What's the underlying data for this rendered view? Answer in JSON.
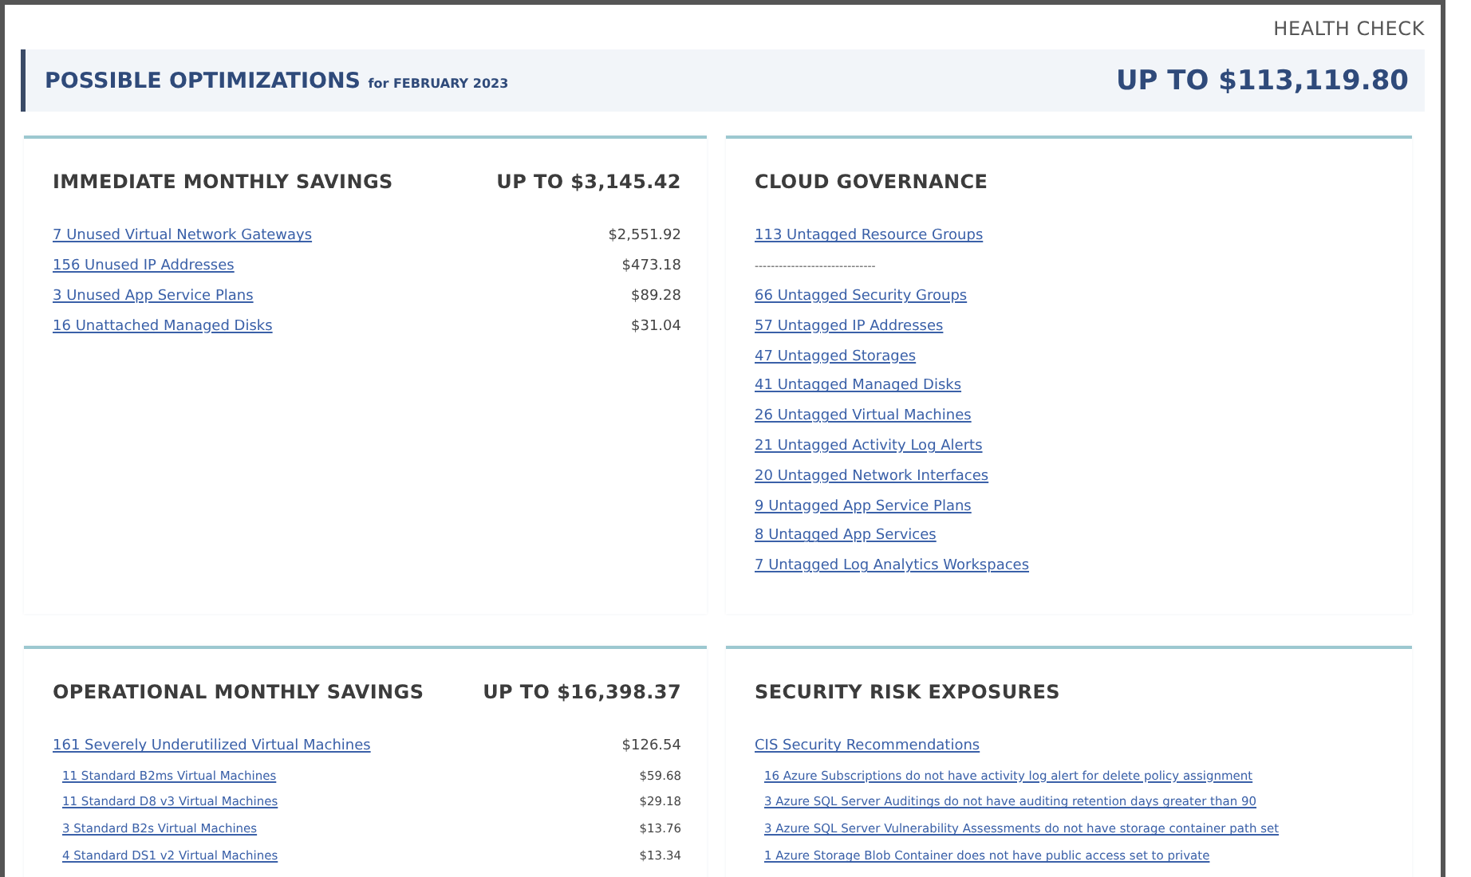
{
  "header": {
    "title": "HEALTH CHECK"
  },
  "banner": {
    "title": "POSSIBLE OPTIMIZATIONS",
    "subtitle": "for FEBRUARY 2023",
    "total": "UP TO $113,119.80"
  },
  "sections": [
    {
      "title": "IMMEDIATE MONTHLY SAVINGS",
      "total": "UP TO $3,145.42",
      "items": [
        {
          "kind": "link",
          "label": "7 Unused Virtual Network Gateways",
          "amount": "$2,551.92"
        },
        {
          "kind": "link",
          "label": "156 Unused IP Addresses",
          "amount": "$473.18"
        },
        {
          "kind": "link",
          "label": "3 Unused App Service Plans",
          "amount": "$89.28"
        },
        {
          "kind": "link",
          "label": "16 Unattached Managed Disks",
          "amount": "$31.04"
        }
      ]
    },
    {
      "title": "CLOUD GOVERNANCE",
      "items": [
        {
          "kind": "link",
          "label": "113 Untagged Resource Groups"
        },
        {
          "kind": "separator",
          "label": "------------------------------"
        },
        {
          "kind": "link",
          "label": "66 Untagged Security Groups"
        },
        {
          "kind": "link",
          "label": "57 Untagged IP Addresses"
        },
        {
          "kind": "link",
          "label": "47 Untagged Storages"
        },
        {
          "kind": "link",
          "label": "41 Untagged Managed Disks"
        },
        {
          "kind": "link",
          "label": "26 Untagged Virtual Machines"
        },
        {
          "kind": "link",
          "label": "21 Untagged Activity Log Alerts"
        },
        {
          "kind": "link",
          "label": "20 Untagged Network Interfaces"
        },
        {
          "kind": "link",
          "label": "9 Untagged App Service Plans"
        },
        {
          "kind": "link",
          "label": "8 Untagged App Services"
        },
        {
          "kind": "link",
          "label": "7 Untagged Log Analytics Workspaces"
        }
      ]
    },
    {
      "title": "OPERATIONAL MONTHLY SAVINGS",
      "total": "UP TO $16,398.37",
      "items": [
        {
          "kind": "link",
          "label": "161 Severely Underutilized Virtual Machines",
          "amount": "$126.54",
          "children": [
            {
              "kind": "link",
              "label": "11 Standard B2ms Virtual Machines",
              "amount": "$59.68"
            },
            {
              "kind": "link",
              "label": "11 Standard D8 v3 Virtual Machines",
              "amount": "$29.18"
            },
            {
              "kind": "link",
              "label": "3 Standard B2s Virtual Machines",
              "amount": "$13.76"
            },
            {
              "kind": "link",
              "label": "4 Standard DS1 v2 Virtual Machines",
              "amount": "$13.34"
            }
          ]
        }
      ]
    },
    {
      "title": "SECURITY RISK EXPOSURES",
      "items": [
        {
          "kind": "link",
          "label": "CIS Security Recommendations",
          "children": [
            {
              "kind": "link",
              "label": "16 Azure Subscriptions do not have activity log alert for delete policy assignment"
            },
            {
              "kind": "link",
              "label": "3 Azure SQL Server Auditings do not have auditing retention days greater than 90"
            },
            {
              "kind": "link",
              "label": "3 Azure SQL Server Vulnerability Assessments do not have storage container path set"
            },
            {
              "kind": "link",
              "label": "1 Azure Storage Blob Container does not have public access set to private"
            }
          ]
        }
      ]
    }
  ]
}
